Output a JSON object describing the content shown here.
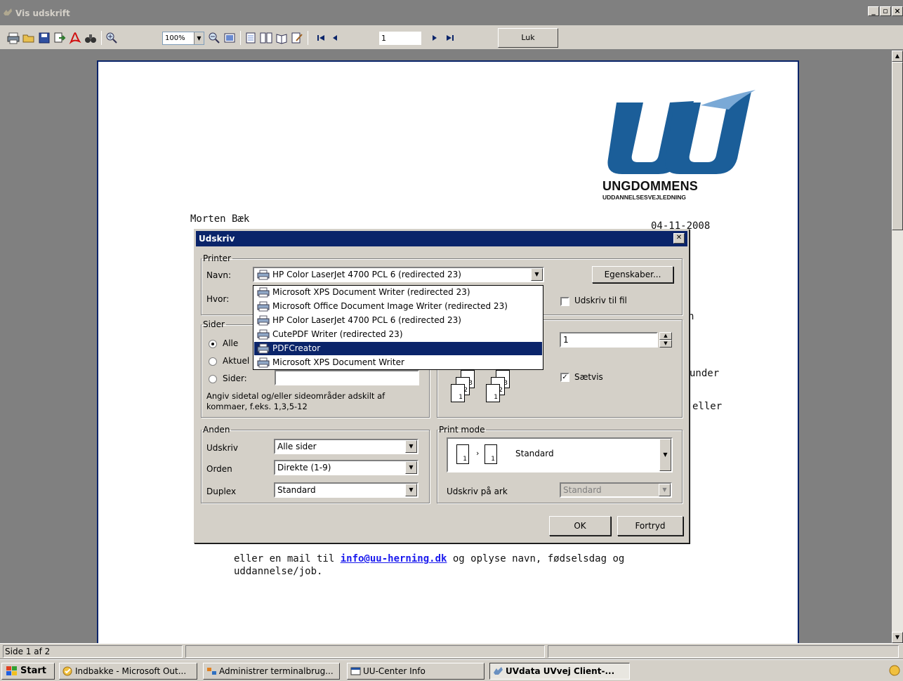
{
  "window": {
    "title": "Vis udskrift"
  },
  "toolbar": {
    "zoom": "100%",
    "page": "1",
    "close_label": "Luk"
  },
  "document": {
    "logo_name": "UNGDOMMENS",
    "logo_sub": "UDDANNELSESVEJLEDNING",
    "name": "Morten Bæk",
    "date": "04-11-2008",
    "fragments": {
      "r1": "h",
      "r2": "under",
      "r3": "eller"
    },
    "bottom_prefix": "eller en mail til ",
    "email": "info@uu-herning.dk",
    "bottom_suffix": " og oplyse navn, fødselsdag og",
    "bottom_line2": "uddannelse/job."
  },
  "dialog": {
    "title": "Udskriv",
    "printer": {
      "legend": "Printer",
      "name_label": "Navn:",
      "where_label": "Hvor:",
      "selected": "HP Color LaserJet 4700 PCL 6 (redirected 23)",
      "properties_button": "Egenskaber...",
      "print_to_file": "Udskriv til fil",
      "options": [
        "Microsoft XPS Document Writer (redirected 23)",
        "Microsoft Office Document Image Writer (redirected 23)",
        "HP Color LaserJet 4700 PCL 6 (redirected 23)",
        "CutePDF Writer (redirected 23)",
        "PDFCreator",
        "Microsoft XPS Document Writer"
      ],
      "highlighted_index": 4
    },
    "pages": {
      "legend": "Sider",
      "all": "Alle",
      "current": "Aktuel",
      "pages": "Sider:",
      "hint1": "Angiv sidetal og/eller sideområder adskilt af",
      "hint2": "kommaer, f.eks. 1,3,5-12"
    },
    "copies": {
      "count": "1",
      "collate": "Sætvis"
    },
    "other": {
      "legend": "Anden",
      "print_label": "Udskriv",
      "print_value": "Alle sider",
      "order_label": "Orden",
      "order_value": "Direkte (1-9)",
      "duplex_label": "Duplex",
      "duplex_value": "Standard"
    },
    "print_mode": {
      "legend": "Print mode",
      "value": "Standard",
      "per_sheet_label": "Udskriv på ark",
      "per_sheet_value": "Standard"
    },
    "ok": "OK",
    "cancel": "Fortryd"
  },
  "status": {
    "page_info": "Side 1 af 2"
  },
  "taskbar": {
    "start": "Start",
    "tasks": [
      "Indbakke - Microsoft Out...",
      "Administrer terminalbrug...",
      "UU-Center Info",
      "UVdata UVvej Client-..."
    ]
  }
}
